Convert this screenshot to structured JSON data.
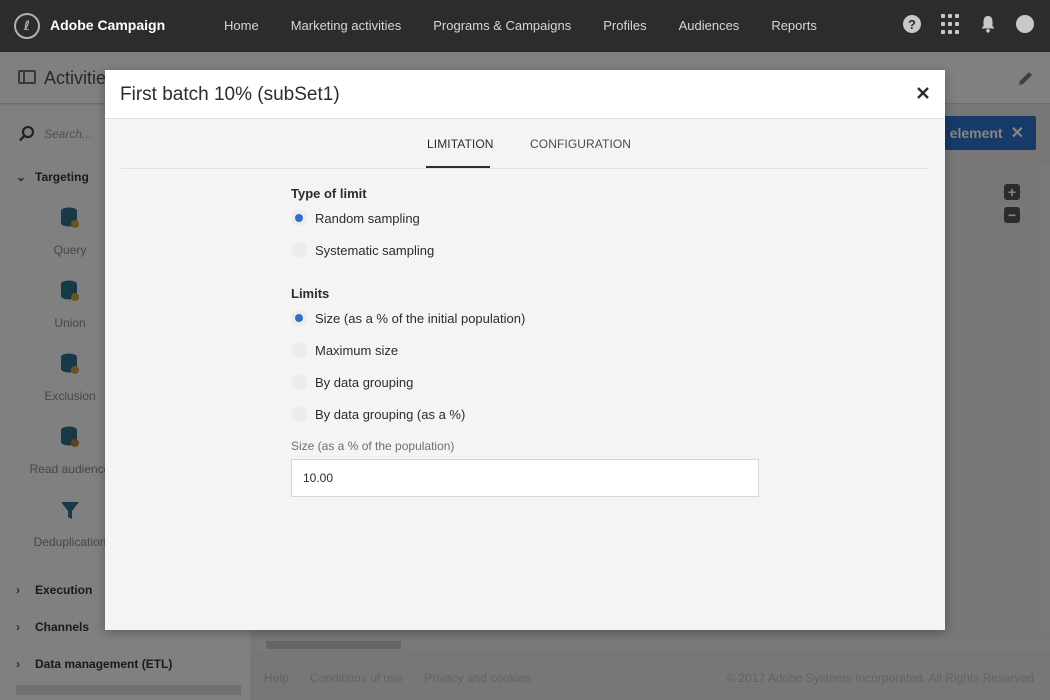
{
  "app": {
    "name": "Adobe Campaign",
    "nav": [
      "Home",
      "Marketing activities",
      "Programs & Campaigns",
      "Profiles",
      "Audiences",
      "Reports"
    ],
    "top_icons": [
      "help-icon",
      "apps-grid-icon",
      "bell-icon",
      "avatar-icon"
    ]
  },
  "workspace": {
    "title": "Activities",
    "search_placeholder": "Search...",
    "add_element_label": "element",
    "sections": {
      "targeting": "Targeting",
      "execution": "Execution",
      "channels": "Channels",
      "data_management": "Data management (ETL)"
    },
    "activities": [
      "Query",
      "Union",
      "Exclusion",
      "Read audience",
      "Deduplication"
    ],
    "footer": {
      "links": [
        "Help",
        "Conditions of use",
        "Privacy and cookies"
      ],
      "copyright": "© 2017 Adobe Systems Incorporated. All Rights Reserved"
    }
  },
  "dialog": {
    "title": "First batch 10% (subSet1)",
    "tabs": [
      "LIMITATION",
      "CONFIGURATION"
    ],
    "active_tab": "LIMITATION",
    "type_of_limit": {
      "label": "Type of limit",
      "options": [
        "Random sampling",
        "Systematic sampling"
      ],
      "selected": "Random sampling"
    },
    "limits": {
      "label": "Limits",
      "options": [
        "Size (as a % of the initial population)",
        "Maximum size",
        "By data grouping",
        "By data grouping (as a %)"
      ],
      "selected": "Size (as a % of the initial population)"
    },
    "size_field": {
      "label": "Size (as a % of the population)",
      "value": "10.00"
    }
  },
  "colors": {
    "topbar": "#2c2c2c",
    "accent": "#2d6fc7",
    "dialog_bg": "#f4f4f4"
  }
}
